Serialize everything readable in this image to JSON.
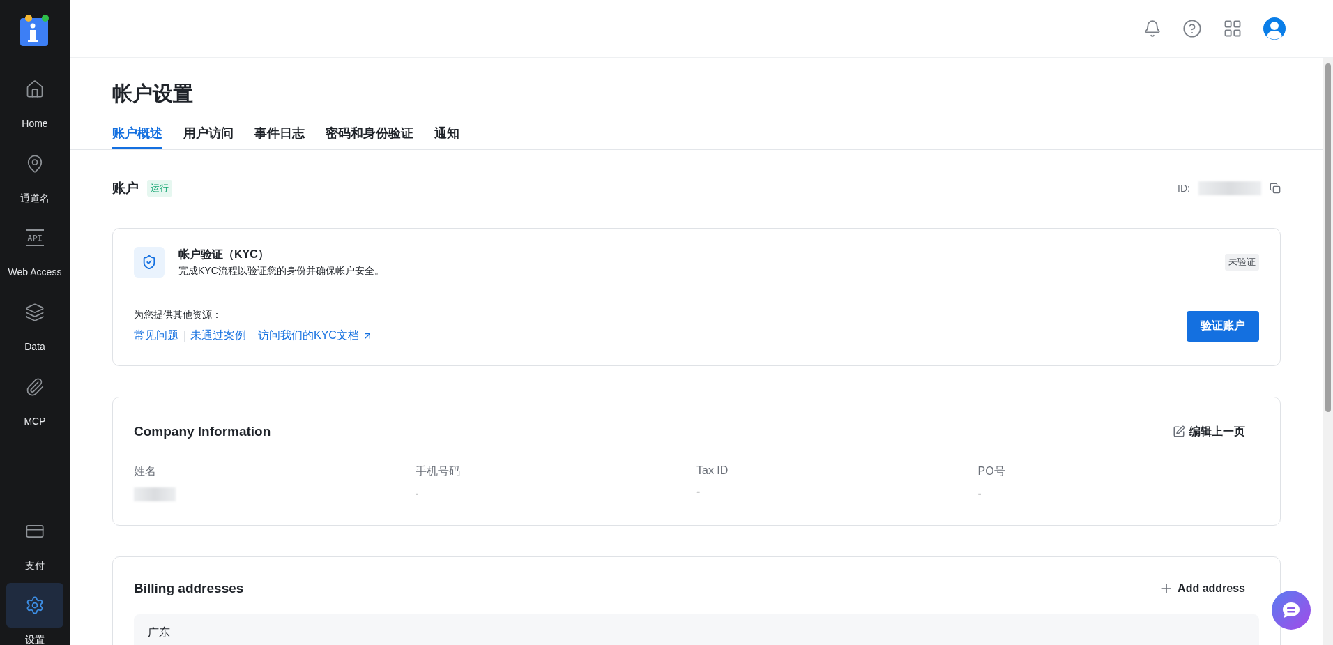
{
  "sidebar": {
    "items": [
      {
        "label": "Home",
        "selected": false
      },
      {
        "label": "通道名",
        "selected": false
      },
      {
        "label": "Web Access",
        "icon_text": "API",
        "selected": false
      },
      {
        "label": "Data",
        "selected": false
      },
      {
        "label": "MCP",
        "selected": false
      },
      {
        "label": "支付",
        "selected": false
      },
      {
        "label": "设置",
        "selected": true
      }
    ]
  },
  "page": {
    "title": "帐户设置",
    "tabs": [
      {
        "label": "账户概述",
        "selected": true
      },
      {
        "label": "用户访问",
        "selected": false
      },
      {
        "label": "事件日志",
        "selected": false
      },
      {
        "label": "密码和身份验证",
        "selected": false
      },
      {
        "label": "通知",
        "selected": false
      }
    ]
  },
  "account": {
    "title": "账户",
    "status": "运行",
    "id_label": "ID:"
  },
  "kyc": {
    "title": "帐户验证（KYC）",
    "description": "完成KYC流程以验证您的身份并确保帐户安全。",
    "status": "未验证",
    "resources_label": "为您提供其他资源：",
    "links": [
      {
        "label": "常见问题",
        "external": false
      },
      {
        "label": "未通过案例",
        "external": false
      },
      {
        "label": "访问我们的KYC文档",
        "external": true
      }
    ],
    "button": "验证账户"
  },
  "company": {
    "title": "Company Information",
    "edit": "编辑上一页",
    "fields": [
      {
        "label": "姓名",
        "redacted": true
      },
      {
        "label": "手机号码",
        "value": "-",
        "redacted": false
      },
      {
        "label": "Tax ID",
        "value": "-",
        "redacted": false
      },
      {
        "label": "PO号",
        "value": "-",
        "redacted": false
      }
    ]
  },
  "billing": {
    "title": "Billing addresses",
    "add": "Add address",
    "addresses": [
      {
        "line_1": "广东"
      }
    ]
  }
}
